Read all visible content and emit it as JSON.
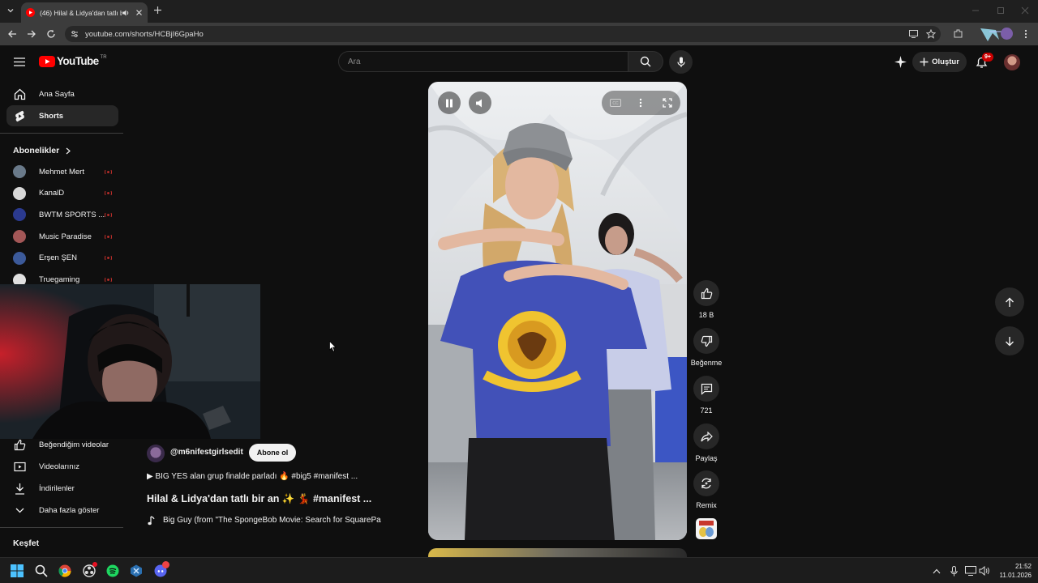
{
  "browser": {
    "tab_title": "(46) Hilal & Lidya'dan tatlı b",
    "url": "youtube.com/shorts/HCBjI6GpaHo"
  },
  "header": {
    "logo_text": "YouTube",
    "country_code": "TR",
    "search_placeholder": "Ara",
    "create_label": "Oluştur",
    "notification_badge": "9+"
  },
  "sidebar": {
    "main_items": [
      {
        "label": "Ana Sayfa",
        "icon": "home-icon"
      },
      {
        "label": "Shorts",
        "icon": "shorts-icon"
      }
    ],
    "subscriptions_title": "Abonelikler",
    "subscriptions": [
      {
        "label": "Mehmet Mert",
        "color": "#6a7a8a"
      },
      {
        "label": "KanalD",
        "color": "#d8d8d8"
      },
      {
        "label": "BWTM SPORTS ...",
        "color": "#2b3a8f"
      },
      {
        "label": "Music Paradise",
        "color": "#a35757"
      },
      {
        "label": "Erşen ŞEN",
        "color": "#3c5a9a"
      },
      {
        "label": "Truegaming",
        "color": "#e0e0e0"
      }
    ],
    "you_items": [
      {
        "label": "Beğendiğim videolar",
        "icon": "thumbs-up-icon"
      },
      {
        "label": "Videolarınız",
        "icon": "your-videos-icon"
      },
      {
        "label": "İndirilenler",
        "icon": "download-icon"
      },
      {
        "label": "Daha fazla göster",
        "icon": "chevron-down-icon"
      }
    ],
    "explore_title": "Keşfet"
  },
  "short": {
    "channel": "@m6nifestgirlsedit",
    "subscribe_label": "Abone ol",
    "playlist_line": "▶ BIG YES alan grup finalde parladı 🔥 #big5 #manifest ...",
    "title": "Hilal & Lidya'dan tatlı bir an ✨ 💃 #manifest ...",
    "sound": "Big Guy (from \"The SpongeBob Movie: Search for SquarePa"
  },
  "actions": {
    "likes": "18 B",
    "dislike_label": "Beğenme",
    "comments": "721",
    "share_label": "Paylaş",
    "remix_label": "Remix"
  },
  "taskbar": {
    "time": "21:52",
    "date": "11.01.2026"
  },
  "colors": {
    "yt_red": "#ff0000",
    "background": "#0f0f0f",
    "shirt_blue": "#4251b8"
  }
}
